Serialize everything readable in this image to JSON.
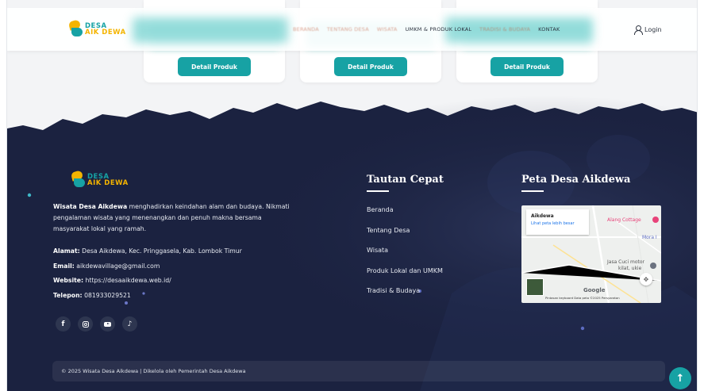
{
  "brand": {
    "line1": "DESA",
    "line2": "AIK DEWA"
  },
  "navbar": {
    "items": [
      "BERANDA",
      "TENTANG DESA",
      "WISATA",
      "UMKM & PRODUK LOKAL",
      "TRADISI & BUDAYA",
      "KONTAK"
    ],
    "login_label": "Login"
  },
  "products": {
    "button_label": "Detail Produk"
  },
  "footer": {
    "about_bold": "Wisata Desa Aikdewa",
    "about_text": " menghadirkan keindahan alam dan budaya. Nikmati pengalaman wisata yang menenangkan dan penuh makna bersama masyarakat lokal yang ramah.",
    "contact": {
      "address_label": "Alamat:",
      "address_value": " Desa Aikdewa, Kec. Pringgasela, Kab. Lombok Timur",
      "email_label": "Email:",
      "email_value": " aikdewavillage@gmail.com",
      "website_label": "Website:",
      "website_value": " https://desaaikdewa.web.id/",
      "phone_label": "Telepon:",
      "phone_value": " 081933029521"
    },
    "quick_links_title": "Tautan Cepat",
    "quick_links": [
      "Beranda",
      "Tentang Desa",
      "Wisata",
      "Produk Lokal dan UMKM",
      "Tradisi & Budaya"
    ],
    "map_title": "Peta Desa Aikdewa",
    "map": {
      "place_name": "Aikdewa",
      "larger_map_link": "Lihat peta lebih besar",
      "poi_1": "Alang Cottage",
      "poi_2": "Mora I",
      "poi_3": "Jasa Cuci motor",
      "poi_4": "kilat, ukie",
      "logo": "Google",
      "attribution": "Pintasan keyboard   Data peta ©2025   Persyaratan"
    },
    "copyright": "© 2025 Wisata Desa Aikdewa | Dikelola oleh Pemerintah Desa Aikdewa"
  },
  "icons": [
    "logo-leaf-icon",
    "user-icon",
    "facebook-icon",
    "instagram-icon",
    "youtube-icon",
    "tiktok-icon",
    "recenter-icon",
    "arrow-up-icon"
  ],
  "colors": {
    "teal": "#17a2a4",
    "gold": "#f4b400",
    "navy": "#1b2240"
  }
}
